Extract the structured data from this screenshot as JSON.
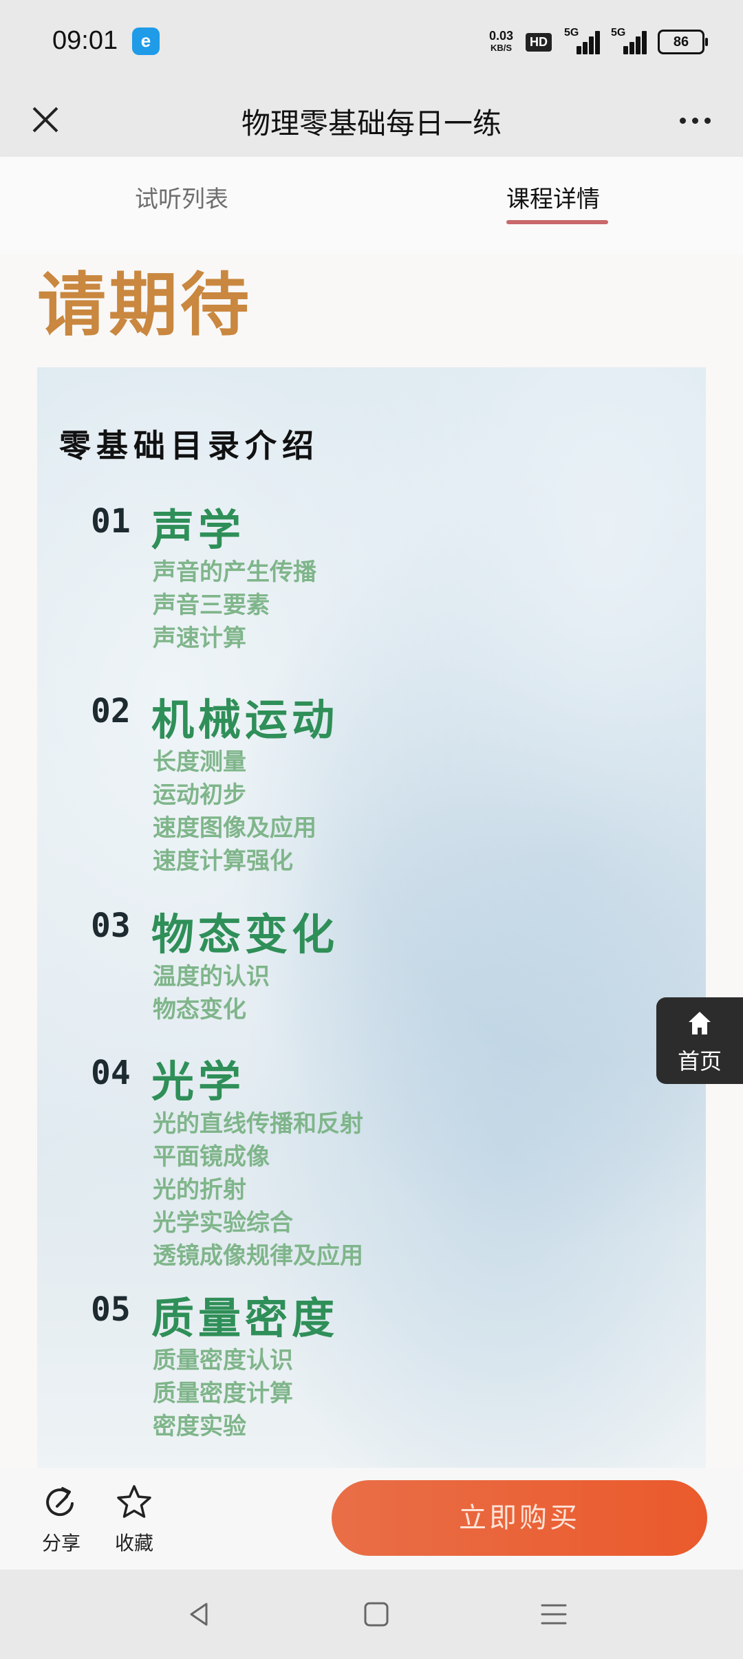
{
  "status_bar": {
    "time": "09:01",
    "app_badge": "e",
    "speed_value": "0.03",
    "speed_unit": "KB/S",
    "hd_label": "HD",
    "signal1_label": "5G",
    "signal2_label": "5G",
    "battery": "86"
  },
  "header": {
    "title": "物理零基础每日一练"
  },
  "tabs": {
    "trial_list": "试听列表",
    "course_details": "课程详情",
    "active": "课程详情"
  },
  "content": {
    "banner_text": "请期待",
    "catalog_title": "零基础目录介绍",
    "sections": [
      {
        "num": "01",
        "name": "声学",
        "items": [
          "声音的产生传播",
          "声音三要素",
          "声速计算"
        ]
      },
      {
        "num": "02",
        "name": "机械运动",
        "items": [
          "长度测量",
          "运动初步",
          "速度图像及应用",
          "速度计算强化"
        ]
      },
      {
        "num": "03",
        "name": "物态变化",
        "items": [
          "温度的认识",
          "物态变化"
        ]
      },
      {
        "num": "04",
        "name": "光学",
        "items": [
          "光的直线传播和反射",
          "平面镜成像",
          "光的折射",
          "光学实验综合",
          "透镜成像规律及应用"
        ]
      },
      {
        "num": "05",
        "name": "质量密度",
        "items": [
          "质量密度认识",
          "质量密度计算",
          "密度实验"
        ]
      }
    ]
  },
  "float_button": {
    "label": "首页",
    "icon": "home-icon"
  },
  "action_bar": {
    "share_label": "分享",
    "favorite_label": "收藏",
    "buy_label": "立即购买"
  },
  "colors": {
    "accent": "#c9686a",
    "buy_button": "#ea5a2c",
    "section_title": "#2f8f58",
    "section_item": "#7fb58a",
    "banner_text": "#c9873f"
  }
}
